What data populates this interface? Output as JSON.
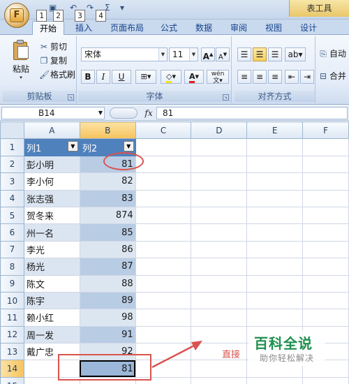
{
  "quick_access": {
    "office_logo": "F",
    "keytips": [
      "1",
      "2",
      "3",
      "4"
    ]
  },
  "context_tab_title": "表工具",
  "ribbon_tabs": [
    {
      "label": "开始",
      "active": true
    },
    {
      "label": "插入"
    },
    {
      "label": "页面布局"
    },
    {
      "label": "公式"
    },
    {
      "label": "数据"
    },
    {
      "label": "审阅"
    },
    {
      "label": "视图"
    },
    {
      "label": "设计"
    }
  ],
  "clipboard": {
    "paste": "粘贴",
    "cut": "剪切",
    "copy": "复制",
    "format_painter": "格式刷",
    "label": "剪贴板"
  },
  "font": {
    "name": "宋体",
    "size": "11",
    "grow": "A",
    "shrink": "A",
    "bold": "B",
    "italic": "I",
    "underline": "U",
    "label": "字体",
    "wen": "wén"
  },
  "alignment": {
    "label": "对齐方式",
    "wrap": "自动",
    "merge": "合并"
  },
  "formula_bar": {
    "name_box": "B14",
    "fx": "fx",
    "value": "81"
  },
  "columns": [
    "A",
    "B",
    "C",
    "D",
    "E",
    "F"
  ],
  "table": {
    "headers": [
      "列1",
      "列2"
    ],
    "rows": [
      {
        "n": "2",
        "a": "彭小明",
        "b": "81"
      },
      {
        "n": "3",
        "a": "李小何",
        "b": "82"
      },
      {
        "n": "4",
        "a": "张志强",
        "b": "83"
      },
      {
        "n": "5",
        "a": "贺冬来",
        "b": "874"
      },
      {
        "n": "6",
        "a": "州一名",
        "b": "85"
      },
      {
        "n": "7",
        "a": "李光",
        "b": "86"
      },
      {
        "n": "8",
        "a": "杨光",
        "b": "87"
      },
      {
        "n": "9",
        "a": "陈文",
        "b": "88"
      },
      {
        "n": "10",
        "a": "陈宇",
        "b": "89"
      },
      {
        "n": "11",
        "a": "赖小红",
        "b": "98"
      },
      {
        "n": "12",
        "a": "周一发",
        "b": "91"
      },
      {
        "n": "13",
        "a": "戴广忠",
        "b": "92"
      },
      {
        "n": "14",
        "a": "",
        "b": "81"
      }
    ],
    "header_row": "1",
    "row15": "15"
  },
  "annotation_text": "直接",
  "watermark": {
    "title": "百科全说",
    "subtitle": "助你轻松解决"
  },
  "colors": {
    "accent": "#4f81bd",
    "annotation": "#d9534f"
  }
}
